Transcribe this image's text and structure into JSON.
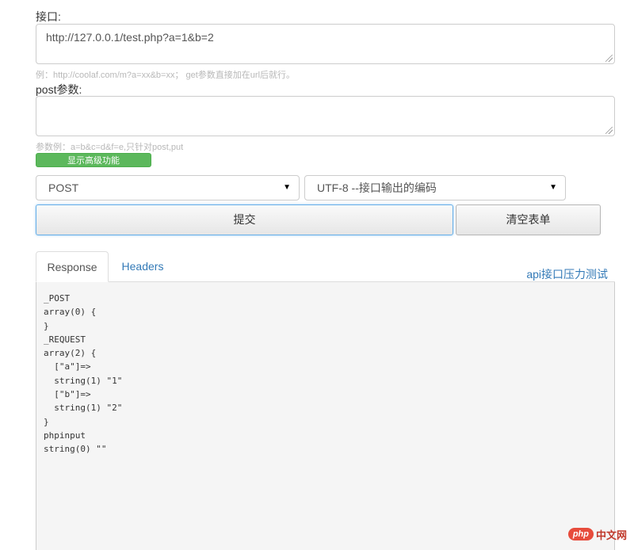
{
  "api": {
    "label": "接口:",
    "url_value": "http://127.0.0.1/test.php?a=1&b=2",
    "hint": "例：http://coolaf.com/m?a=xx&b=xx；  get参数直接加在url后就行。"
  },
  "post": {
    "label": "post参数:",
    "value": "",
    "hint": "参数例：a=b&c=d&f=e,只针对post,put"
  },
  "advanced_button": "显示高级功能",
  "method_select": {
    "selected": "POST"
  },
  "encoding_select": {
    "selected": "UTF-8 --接口输出的编码"
  },
  "buttons": {
    "submit": "提交",
    "clear": "清空表单"
  },
  "tabs": [
    {
      "label": "Response",
      "active": true
    },
    {
      "label": "Headers",
      "active": false
    }
  ],
  "pressure_test_link": "api接口压力测试",
  "response_text": "_POST\narray(0) {\n}\n_REQUEST\narray(2) {\n  [\"a\"]=>\n  string(1) \"1\"\n  [\"b\"]=>\n  string(1) \"2\"\n}\nphpinput\nstring(0) \"\"",
  "watermark": {
    "logo": "php",
    "text": "中文网"
  },
  "colors": {
    "primary_link": "#337ab7",
    "success": "#5cb85c",
    "focus_border": "#66afe9"
  }
}
